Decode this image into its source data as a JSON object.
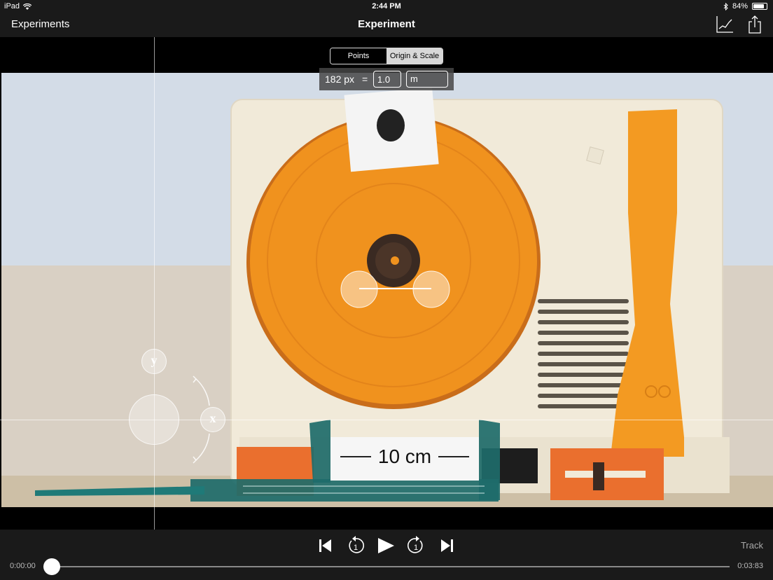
{
  "status_bar": {
    "device": "iPad",
    "time": "2:44 PM",
    "battery": "84%",
    "battery_level": 0.84,
    "icons": [
      "wifi-icon",
      "bluetooth-icon",
      "battery-icon"
    ]
  },
  "nav": {
    "back_label": "Experiments",
    "title": "Experiment",
    "icons": [
      "graph-icon",
      "share-icon"
    ]
  },
  "segment": {
    "options": [
      "Points",
      "Origin & Scale"
    ],
    "selected": "Origin & Scale"
  },
  "scale": {
    "pixels": "182 px",
    "equals": "=",
    "value": "1.0",
    "unit": "m"
  },
  "axes": {
    "x_label": "x",
    "y_label": "y"
  },
  "video": {
    "ruler_label": "10 cm"
  },
  "playback": {
    "track_label": "Track",
    "current_time": "0:00:00",
    "end_time": "0:03:83",
    "progress": 0.0,
    "icons": [
      "skip-start-icon",
      "step-back-icon",
      "play-icon",
      "step-forward-icon",
      "skip-end-icon"
    ]
  },
  "colors": {
    "bar_bg": "#1a1a1a",
    "turntable_orange": "#f0921e",
    "player_body": "#f1ead9"
  }
}
